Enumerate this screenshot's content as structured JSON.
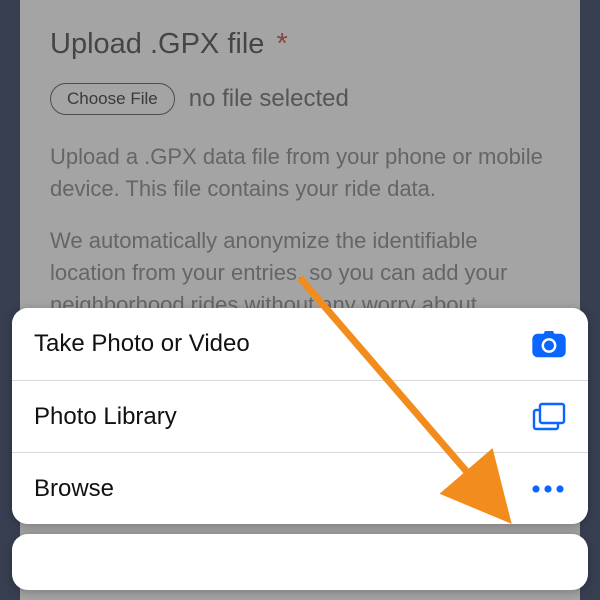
{
  "page": {
    "heading": "Upload .GPX file",
    "required_mark": "*",
    "choose_button": "Choose File",
    "file_status": "no file selected",
    "helper1": "Upload a .GPX data file from your phone or mobile device. This file contains your ride data.",
    "helper2": "We automatically anonymize the identifiable location from your entries, so you can add your neighborhood rides without any worry about"
  },
  "sheet": {
    "items": [
      {
        "label": "Take Photo or Video",
        "icon": "camera"
      },
      {
        "label": "Photo Library",
        "icon": "stack"
      },
      {
        "label": "Browse",
        "icon": "more"
      }
    ]
  },
  "colors": {
    "accent": "#0a66ff",
    "arrow": "#f28c1c"
  }
}
